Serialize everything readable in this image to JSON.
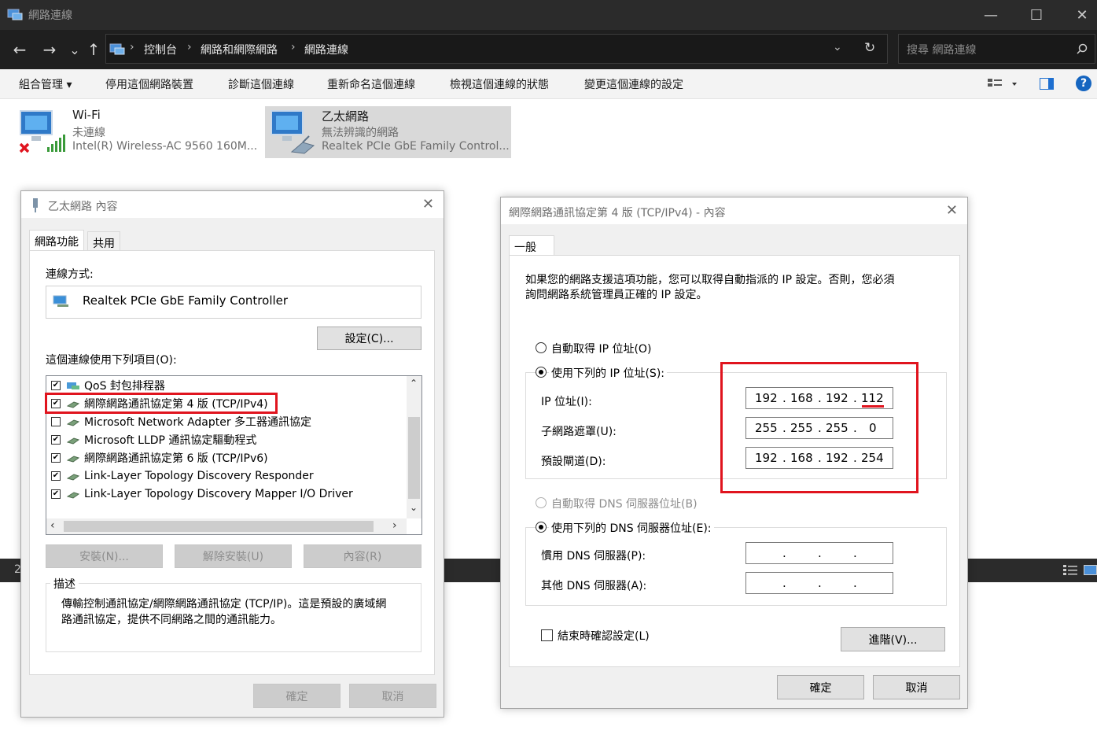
{
  "window": {
    "title": "網路連線",
    "minimize": "—",
    "maximize": "☐",
    "close": "✕"
  },
  "nav": {
    "back": "←",
    "forward": "→",
    "recent": "⌄",
    "up": "↑",
    "breadcrumb": [
      "控制台",
      "網路和網際網路",
      "網路連線"
    ],
    "search_placeholder": "搜尋 網路連線"
  },
  "commands": [
    "組合管理 ▾",
    "停用這個網路裝置",
    "診斷這個連線",
    "重新命名這個連線",
    "檢視這個連線的狀態",
    "變更這個連線的設定"
  ],
  "adapters": [
    {
      "name": "Wi-Fi",
      "status": "未連線",
      "device": "Intel(R) Wireless-AC 9560 160M..."
    },
    {
      "name": "乙太網路",
      "status": "無法辨識的網路",
      "device": "Realtek PCIe GbE Family Control..."
    }
  ],
  "statusbar": {
    "count": "2"
  },
  "eth_props": {
    "title": "乙太網路 內容",
    "tabs": [
      "網路功能",
      "共用"
    ],
    "connect_using_label": "連線方式:",
    "adapter_name": "Realtek PCIe GbE Family Controller",
    "configure": "設定(C)...",
    "items_label": "這個連線使用下列項目(O):",
    "items": [
      {
        "label": "QoS 封包排程器",
        "checked": true
      },
      {
        "label": "網際網路通訊協定第 4 版 (TCP/IPv4)",
        "checked": true
      },
      {
        "label": "Microsoft Network Adapter 多工器通訊協定",
        "checked": false
      },
      {
        "label": "Microsoft LLDP 通訊協定驅動程式",
        "checked": true
      },
      {
        "label": "網際網路通訊協定第 6 版 (TCP/IPv6)",
        "checked": true
      },
      {
        "label": "Link-Layer Topology Discovery Responder",
        "checked": true
      },
      {
        "label": "Link-Layer Topology Discovery Mapper I/O Driver",
        "checked": true
      }
    ],
    "install": "安裝(N)...",
    "uninstall": "解除安裝(U)",
    "properties": "內容(R)",
    "description_label": "描述",
    "description_line1": "傳輸控制通訊協定/網際網路通訊協定 (TCP/IP)。這是預設的廣域網",
    "description_line2": "路通訊協定，提供不同網路之間的通訊能力。",
    "ok": "確定",
    "cancel": "取消"
  },
  "ipv4_props": {
    "title": "網際網路通訊協定第 4 版 (TCP/IPv4) - 內容",
    "tab": "一般",
    "info_line1": "如果您的網路支援這項功能，您可以取得自動指派的 IP 設定。否則，您必須",
    "info_line2": "詢問網路系統管理員正確的 IP 設定。",
    "auto_ip": "自動取得 IP 位址(O)",
    "manual_ip": "使用下列的 IP 位址(S):",
    "ip_label": "IP 位址(I):",
    "ip": [
      "192",
      "168",
      "192",
      "112"
    ],
    "mask_label": "子網路遮罩(U):",
    "mask": [
      "255",
      "255",
      "255",
      "0"
    ],
    "gateway_label": "預設閘道(D):",
    "gateway": [
      "192",
      "168",
      "192",
      "254"
    ],
    "auto_dns": "自動取得 DNS 伺服器位址(B)",
    "manual_dns": "使用下列的 DNS 伺服器位址(E):",
    "pref_dns_label": "慣用 DNS 伺服器(P):",
    "alt_dns_label": "其他 DNS 伺服器(A):",
    "validate": "結束時確認設定(L)",
    "advanced": "進階(V)...",
    "ok": "確定",
    "cancel": "取消"
  },
  "colors": {
    "highlight": "#e0141e",
    "selected_adapter": "#d9d9d9"
  }
}
